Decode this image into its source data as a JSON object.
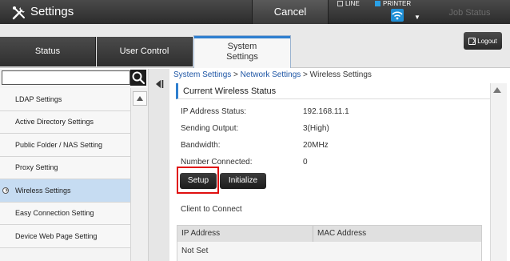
{
  "header": {
    "app_title": "Settings",
    "app_icon": "settings-tools-icon",
    "cancel_label": "Cancel",
    "line_label": "LINE",
    "printer_label": "PRINTER",
    "job_status_label": "Job Status",
    "logout_label": "Logout"
  },
  "tabs": [
    {
      "label": "Status"
    },
    {
      "label": "User Control"
    },
    {
      "label": "System\nSettings"
    }
  ],
  "sidebar": {
    "search_placeholder": "",
    "items": [
      {
        "label": "LDAP Settings"
      },
      {
        "label": "Active Directory Settings"
      },
      {
        "label": "Public Folder / NAS Setting"
      },
      {
        "label": "Proxy Setting"
      },
      {
        "label": "Wireless Settings",
        "active": true
      },
      {
        "label": "Easy Connection Setting"
      },
      {
        "label": "Device Web Page Setting"
      }
    ]
  },
  "breadcrumb": {
    "system": "System Settings",
    "sep1": " > ",
    "network": "Network Settings",
    "sep2": " > ",
    "current": "Wireless Settings"
  },
  "wireless": {
    "section_title": "Current Wireless Status",
    "fields": [
      {
        "label": "IP Address Status:",
        "value": "192.168.11.1"
      },
      {
        "label": "Sending Output:",
        "value": "3(High)"
      },
      {
        "label": "Bandwidth:",
        "value": "20MHz"
      },
      {
        "label": "Number Connected:",
        "value": "0"
      }
    ],
    "setup_label": "Setup",
    "initialize_label": "Initialize",
    "client_label": "Client to Connect",
    "table": {
      "headers": [
        "IP Address",
        "MAC Address"
      ],
      "rows": [
        [
          "Not Set",
          ""
        ]
      ]
    }
  },
  "colors": {
    "accent": "#2f7fcf",
    "highlight_box": "#e01010",
    "active_item": "#c6dcf2"
  }
}
